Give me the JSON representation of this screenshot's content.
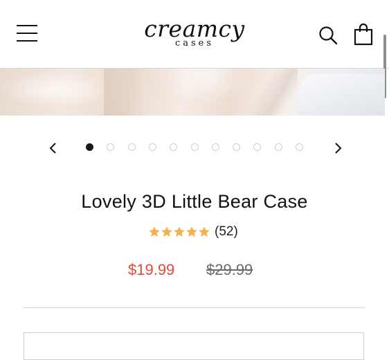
{
  "header": {
    "brand_main": "creamcy",
    "brand_sub": "cases"
  },
  "icons": {
    "menu": "hamburger-menu-icon",
    "search": "search-icon",
    "cart": "shopping-bag-icon",
    "prev": "chevron-left-icon",
    "next": "chevron-right-icon",
    "star": "star-icon"
  },
  "carousel": {
    "total_slides": 11,
    "active_index": 0
  },
  "product": {
    "title": "Lovely 3D Little Bear Case",
    "rating": 5,
    "review_count": "(52)",
    "sale_price": "$19.99",
    "regular_price": "$29.99"
  },
  "colors": {
    "sale": "#e0483a",
    "star": "#f3b24e",
    "text": "#111111"
  }
}
